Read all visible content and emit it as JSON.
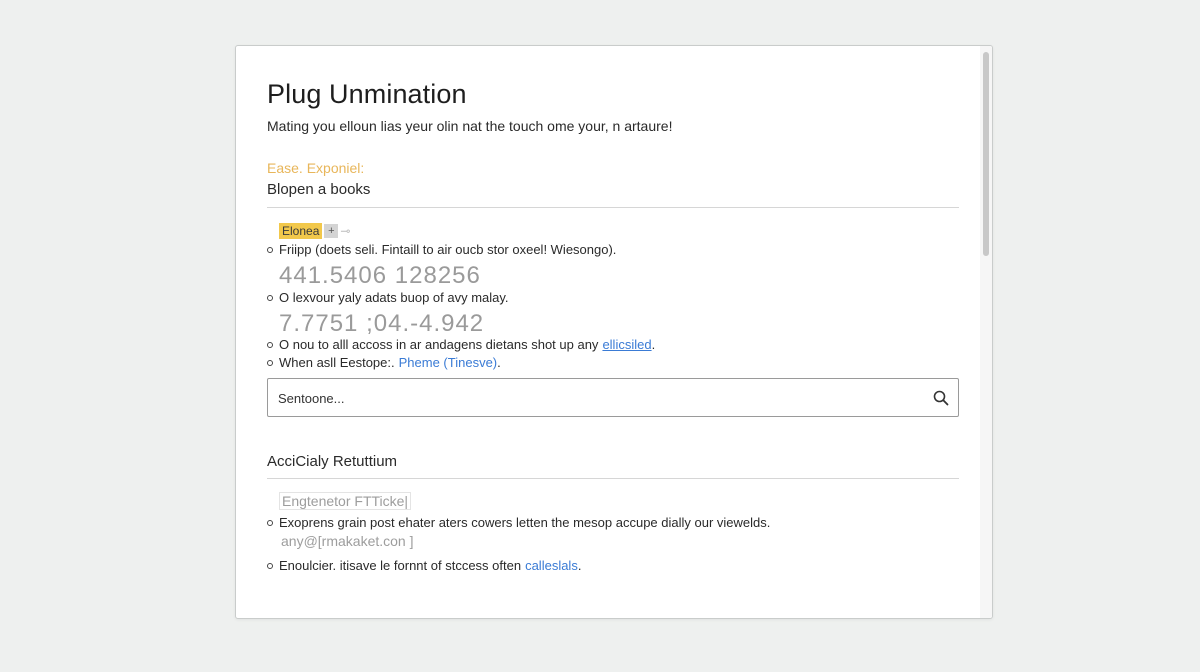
{
  "page": {
    "title": "Plug Unmination",
    "subtitle": "Mating you elloun lias yeur olin nat the touch ome your, n artaure!"
  },
  "section1": {
    "eyebrow": "Ease. Exponiel:",
    "heading": "Blopen a books",
    "tag": {
      "label": "Elonea",
      "plus": "+",
      "tail": "⊸"
    },
    "items": [
      {
        "text": "Friipp (doets seli. Fintaill to air oucb stor oxeel! Wiesongo)."
      },
      {
        "text": "O lexvour yaly adats buop of avy malay."
      },
      {
        "text": "O nou to alll accoss in ar andagens dietans shot up any",
        "link": "ellicsiled",
        "after": "."
      },
      {
        "text": "When asll Eestope:.",
        "link": "Pheme (Tinesve)",
        "after": "."
      }
    ],
    "values": [
      "441.5406 128256",
      "7.7751 ;04.-4.942"
    ]
  },
  "search": {
    "placeholder": "Sentoone..."
  },
  "section2": {
    "heading": "AcciCialy Retuttium",
    "ghost1": "Engtenetor FTTicke|",
    "ghost2": "any@[rmakaket.con ]",
    "items": [
      {
        "text": "Exoprens grain post ehater aters cowers letten the mesop accupe dially our viewelds."
      },
      {
        "text": "Enoulcier. itisave le fornnt of stccess often",
        "link": "calleslals",
        "after": "."
      }
    ]
  },
  "colors": {
    "accent_yellow": "#f2c84b",
    "link_blue": "#3a7bd5",
    "eyebrow": "#e8b65a"
  }
}
